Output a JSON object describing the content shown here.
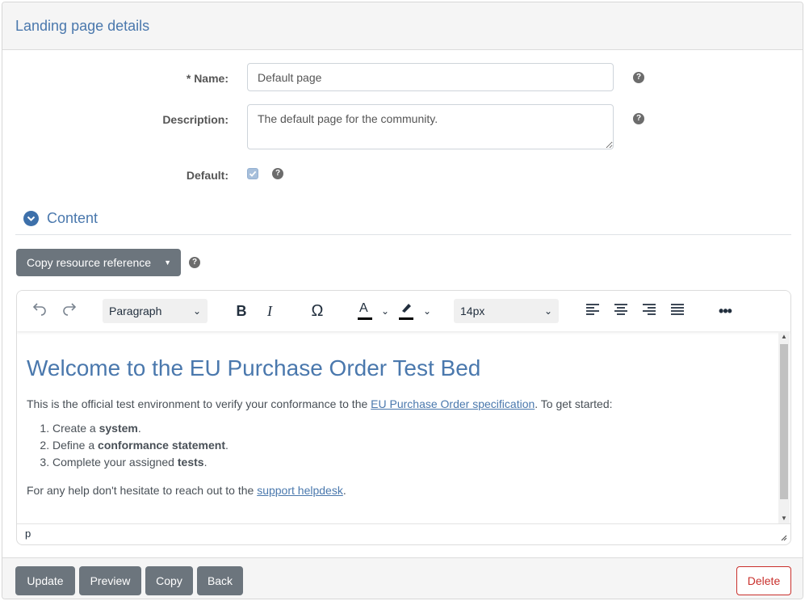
{
  "panel": {
    "title": "Landing page details"
  },
  "form": {
    "name_label": "* Name:",
    "name_value": "Default page",
    "description_label": "Description:",
    "description_value": "The default page for the community.",
    "default_label": "Default:",
    "default_checked": true
  },
  "content_section": {
    "title": "Content"
  },
  "copy_resource_button": "Copy resource reference",
  "editor": {
    "toolbar": {
      "block_format": "Paragraph",
      "font_size": "14px",
      "icons": [
        "undo-icon",
        "redo-icon",
        "bold-icon",
        "italic-icon",
        "special-char-icon",
        "text-color-icon",
        "highlight-color-icon",
        "align-left-icon",
        "align-center-icon",
        "align-right-icon",
        "justify-icon",
        "more-icon"
      ]
    },
    "heading": "Welcome to the EU Purchase Order Test Bed",
    "intro_before": "This is the official test environment to verify your conformance to the ",
    "intro_link": "EU Purchase Order specification",
    "intro_after": ". To get started:",
    "steps": [
      {
        "before": "Create a ",
        "bold": "system",
        "after": "."
      },
      {
        "before": "Define a ",
        "bold": "conformance statement",
        "after": "."
      },
      {
        "before": "Complete your assigned ",
        "bold": "tests",
        "after": "."
      }
    ],
    "help_before": "For any help don't hesitate to reach out to the ",
    "help_link": "support helpdesk",
    "help_after": ".",
    "status_path": "p"
  },
  "footer": {
    "update_label": "Update",
    "preview_label": "Preview",
    "copy_label": "Copy",
    "back_label": "Back",
    "delete_label": "Delete"
  },
  "colors": {
    "accent": "#4a78ad",
    "button_dark": "#6c757d",
    "danger": "#c9302c"
  }
}
